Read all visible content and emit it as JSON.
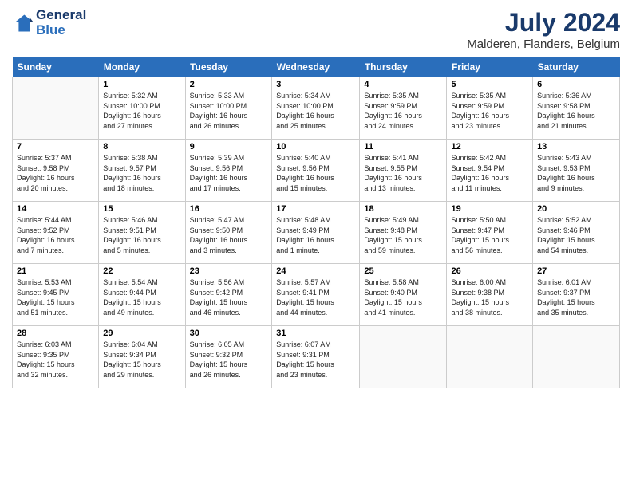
{
  "header": {
    "logo_line1": "General",
    "logo_line2": "Blue",
    "month_year": "July 2024",
    "location": "Malderen, Flanders, Belgium"
  },
  "weekdays": [
    "Sunday",
    "Monday",
    "Tuesday",
    "Wednesday",
    "Thursday",
    "Friday",
    "Saturday"
  ],
  "weeks": [
    [
      {
        "day": "",
        "info": ""
      },
      {
        "day": "1",
        "info": "Sunrise: 5:32 AM\nSunset: 10:00 PM\nDaylight: 16 hours\nand 27 minutes."
      },
      {
        "day": "2",
        "info": "Sunrise: 5:33 AM\nSunset: 10:00 PM\nDaylight: 16 hours\nand 26 minutes."
      },
      {
        "day": "3",
        "info": "Sunrise: 5:34 AM\nSunset: 10:00 PM\nDaylight: 16 hours\nand 25 minutes."
      },
      {
        "day": "4",
        "info": "Sunrise: 5:35 AM\nSunset: 9:59 PM\nDaylight: 16 hours\nand 24 minutes."
      },
      {
        "day": "5",
        "info": "Sunrise: 5:35 AM\nSunset: 9:59 PM\nDaylight: 16 hours\nand 23 minutes."
      },
      {
        "day": "6",
        "info": "Sunrise: 5:36 AM\nSunset: 9:58 PM\nDaylight: 16 hours\nand 21 minutes."
      }
    ],
    [
      {
        "day": "7",
        "info": "Sunrise: 5:37 AM\nSunset: 9:58 PM\nDaylight: 16 hours\nand 20 minutes."
      },
      {
        "day": "8",
        "info": "Sunrise: 5:38 AM\nSunset: 9:57 PM\nDaylight: 16 hours\nand 18 minutes."
      },
      {
        "day": "9",
        "info": "Sunrise: 5:39 AM\nSunset: 9:56 PM\nDaylight: 16 hours\nand 17 minutes."
      },
      {
        "day": "10",
        "info": "Sunrise: 5:40 AM\nSunset: 9:56 PM\nDaylight: 16 hours\nand 15 minutes."
      },
      {
        "day": "11",
        "info": "Sunrise: 5:41 AM\nSunset: 9:55 PM\nDaylight: 16 hours\nand 13 minutes."
      },
      {
        "day": "12",
        "info": "Sunrise: 5:42 AM\nSunset: 9:54 PM\nDaylight: 16 hours\nand 11 minutes."
      },
      {
        "day": "13",
        "info": "Sunrise: 5:43 AM\nSunset: 9:53 PM\nDaylight: 16 hours\nand 9 minutes."
      }
    ],
    [
      {
        "day": "14",
        "info": "Sunrise: 5:44 AM\nSunset: 9:52 PM\nDaylight: 16 hours\nand 7 minutes."
      },
      {
        "day": "15",
        "info": "Sunrise: 5:46 AM\nSunset: 9:51 PM\nDaylight: 16 hours\nand 5 minutes."
      },
      {
        "day": "16",
        "info": "Sunrise: 5:47 AM\nSunset: 9:50 PM\nDaylight: 16 hours\nand 3 minutes."
      },
      {
        "day": "17",
        "info": "Sunrise: 5:48 AM\nSunset: 9:49 PM\nDaylight: 16 hours\nand 1 minute."
      },
      {
        "day": "18",
        "info": "Sunrise: 5:49 AM\nSunset: 9:48 PM\nDaylight: 15 hours\nand 59 minutes."
      },
      {
        "day": "19",
        "info": "Sunrise: 5:50 AM\nSunset: 9:47 PM\nDaylight: 15 hours\nand 56 minutes."
      },
      {
        "day": "20",
        "info": "Sunrise: 5:52 AM\nSunset: 9:46 PM\nDaylight: 15 hours\nand 54 minutes."
      }
    ],
    [
      {
        "day": "21",
        "info": "Sunrise: 5:53 AM\nSunset: 9:45 PM\nDaylight: 15 hours\nand 51 minutes."
      },
      {
        "day": "22",
        "info": "Sunrise: 5:54 AM\nSunset: 9:44 PM\nDaylight: 15 hours\nand 49 minutes."
      },
      {
        "day": "23",
        "info": "Sunrise: 5:56 AM\nSunset: 9:42 PM\nDaylight: 15 hours\nand 46 minutes."
      },
      {
        "day": "24",
        "info": "Sunrise: 5:57 AM\nSunset: 9:41 PM\nDaylight: 15 hours\nand 44 minutes."
      },
      {
        "day": "25",
        "info": "Sunrise: 5:58 AM\nSunset: 9:40 PM\nDaylight: 15 hours\nand 41 minutes."
      },
      {
        "day": "26",
        "info": "Sunrise: 6:00 AM\nSunset: 9:38 PM\nDaylight: 15 hours\nand 38 minutes."
      },
      {
        "day": "27",
        "info": "Sunrise: 6:01 AM\nSunset: 9:37 PM\nDaylight: 15 hours\nand 35 minutes."
      }
    ],
    [
      {
        "day": "28",
        "info": "Sunrise: 6:03 AM\nSunset: 9:35 PM\nDaylight: 15 hours\nand 32 minutes."
      },
      {
        "day": "29",
        "info": "Sunrise: 6:04 AM\nSunset: 9:34 PM\nDaylight: 15 hours\nand 29 minutes."
      },
      {
        "day": "30",
        "info": "Sunrise: 6:05 AM\nSunset: 9:32 PM\nDaylight: 15 hours\nand 26 minutes."
      },
      {
        "day": "31",
        "info": "Sunrise: 6:07 AM\nSunset: 9:31 PM\nDaylight: 15 hours\nand 23 minutes."
      },
      {
        "day": "",
        "info": ""
      },
      {
        "day": "",
        "info": ""
      },
      {
        "day": "",
        "info": ""
      }
    ]
  ]
}
